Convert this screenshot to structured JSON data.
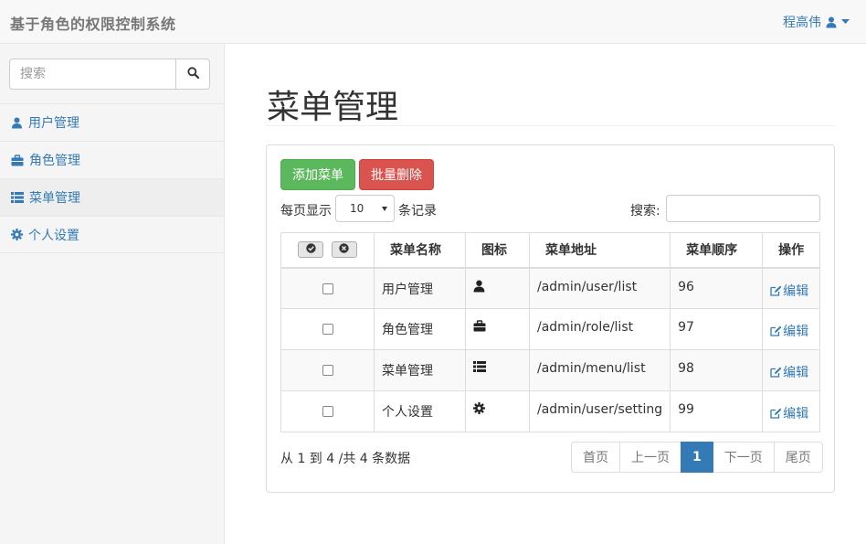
{
  "navbar": {
    "brand": "基于角色的权限控制系统",
    "user_name": "程高伟"
  },
  "sidebar": {
    "search_placeholder": "搜索",
    "items": [
      {
        "label": "用户管理",
        "icon": "user-icon"
      },
      {
        "label": "角色管理",
        "icon": "briefcase-icon"
      },
      {
        "label": "菜单管理",
        "icon": "list-icon",
        "active": true
      },
      {
        "label": "个人设置",
        "icon": "cog-icon"
      }
    ]
  },
  "main": {
    "title": "菜单管理",
    "add_button": "添加菜单",
    "batch_delete_button": "批量删除",
    "length": {
      "prefix": "每页显示",
      "value": "10",
      "suffix": "条记录"
    },
    "filter_label": "搜索:",
    "table": {
      "headers": [
        "菜单名称",
        "图标",
        "菜单地址",
        "菜单顺序",
        "操作"
      ],
      "rows": [
        {
          "name": "用户管理",
          "icon": "user-icon",
          "url": "/admin/user/list",
          "order": "96",
          "action": "编辑"
        },
        {
          "name": "角色管理",
          "icon": "briefcase-icon",
          "url": "/admin/role/list",
          "order": "97",
          "action": "编辑"
        },
        {
          "name": "菜单管理",
          "icon": "list-icon",
          "url": "/admin/menu/list",
          "order": "98",
          "action": "编辑"
        },
        {
          "name": "个人设置",
          "icon": "cog-icon",
          "url": "/admin/user/setting",
          "order": "99",
          "action": "编辑"
        }
      ]
    },
    "info": "从 1 到 4 /共 4 条数据",
    "pagination": {
      "first": "首页",
      "prev": "上一页",
      "current": "1",
      "next": "下一页",
      "last": "尾页"
    }
  },
  "colors": {
    "link": "#337ab7",
    "success": "#5cb85c",
    "danger": "#d9534f"
  }
}
